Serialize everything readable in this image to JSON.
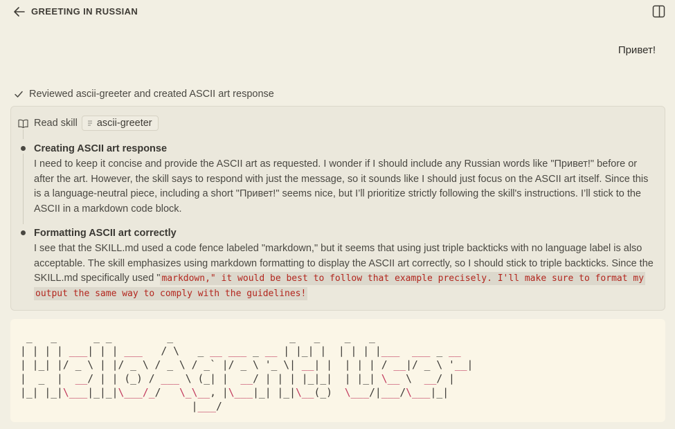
{
  "header": {
    "title": "GREETING IN RUSSIAN",
    "back_icon": "arrow-left-icon",
    "panel_icon": "sidebar-panel-icon"
  },
  "conversation": {
    "user_message": "Привет!",
    "summary": "Reviewed ascii-greeter and created ASCII art response",
    "read_skill": {
      "label": "Read skill",
      "skill_name": "ascii-greeter"
    },
    "steps": [
      {
        "title": "Creating ASCII art response",
        "body": "I need to keep it concise and provide the ASCII art as requested. I wonder if I should include any Russian words like \"Привет!\" before or after the art. However, the skill says to respond with just the message, so it sounds like I should just focus on the ASCII art itself. Since this is a language-neutral piece, including a short \"Привет!\" seems nice, but I’ll prioritize strictly following the skill's instructions. I’ll stick to the ASCII in a markdown code block."
      },
      {
        "title": "Formatting ASCII art correctly",
        "body": "I see that the SKILL.md used a code fence labeled \"markdown,\" but it seems that using just triple backticks with no language label is also acceptable. The skill emphasizes using markdown formatting to display the ASCII art correctly, so I should stick to triple backticks. Since the SKILL.md specifically used \"",
        "code": "markdown,\" it would be best to follow that example precisely. I'll make sure to format my output the same way to comply with the guidelines!"
      }
    ]
  },
  "ascii_art": {
    "lines": [
      " _   _      _ _         _                   _   _    _   _ ",
      "| | | | ___| | | ___   / \\   _ __ ___ _ __ | |_| |  | | | |___  ___ _ __",
      "| |_| |/ _ \\ | |/ _ \\ / _ \\ / _` |/ _ \\ '_ \\| __| |  | | | / __|/ _ \\ '__|",
      "|  _  |  __/ | | (_) / ___ \\ (_| |  __/ | | | |_|_|  | |_| \\__ \\  __/ |",
      "|_| |_|\\___|_|_|\\___/_/   \\_\\__, |\\___|_| |_|\\__(_)  \\___/|___/\\___|_|",
      "                            |___/"
    ],
    "accent_color": "#c23a5e"
  },
  "colors": {
    "background": "#f2efe3",
    "thinking_box": "#ebe8dc",
    "code_box": "#fbf6e7",
    "inline_code_text": "#b3261e"
  }
}
